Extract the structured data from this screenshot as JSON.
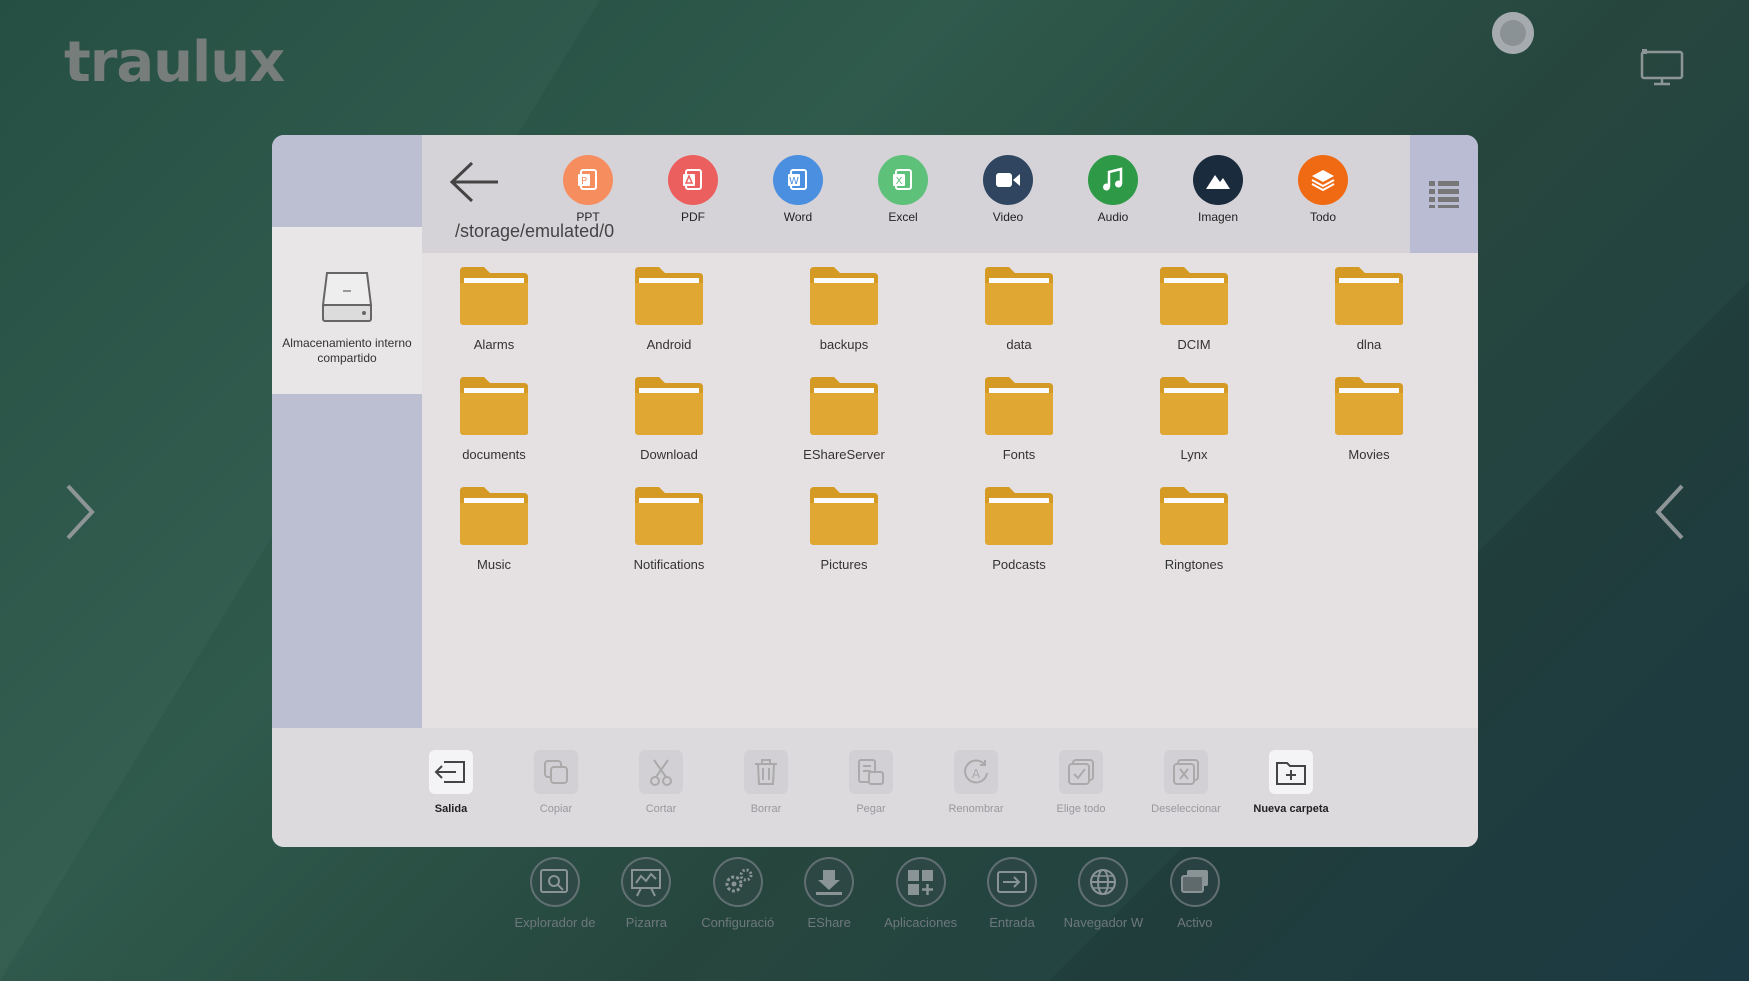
{
  "brand": {
    "logo": "traulux"
  },
  "path": "/storage/emulated/0",
  "sidebar": {
    "storage_label": "Almacenamiento interno compartido"
  },
  "categories": [
    {
      "label": "PPT",
      "icon": "ppt-icon",
      "color": "#f58d5f"
    },
    {
      "label": "PDF",
      "icon": "pdf-icon",
      "color": "#ec5f5f"
    },
    {
      "label": "Word",
      "icon": "word-icon",
      "color": "#4b8fe0"
    },
    {
      "label": "Excel",
      "icon": "excel-icon",
      "color": "#5ec179"
    },
    {
      "label": "Video",
      "icon": "video-icon",
      "color": "#2f4560"
    },
    {
      "label": "Audio",
      "icon": "music-icon",
      "color": "#2e9a47"
    },
    {
      "label": "Imagen",
      "icon": "image-icon",
      "color": "#1b2b3e"
    },
    {
      "label": "Todo",
      "icon": "layers-icon",
      "color": "#ef6a12"
    }
  ],
  "folders": [
    "Alarms",
    "Android",
    "backups",
    "data",
    "DCIM",
    "dlna",
    "documents",
    "Download",
    "EShareServer",
    "Fonts",
    "Lynx",
    "Movies",
    "Music",
    "Notifications",
    "Pictures",
    "Podcasts",
    "Ringtones"
  ],
  "actions": [
    {
      "label": "Salida",
      "icon": "exit-icon",
      "enabled": true
    },
    {
      "label": "Copiar",
      "icon": "copy-icon",
      "enabled": false
    },
    {
      "label": "Cortar",
      "icon": "scissors-icon",
      "enabled": false
    },
    {
      "label": "Borrar",
      "icon": "trash-icon",
      "enabled": false
    },
    {
      "label": "Pegar",
      "icon": "paste-icon",
      "enabled": false
    },
    {
      "label": "Renombrar",
      "icon": "rename-icon",
      "enabled": false
    },
    {
      "label": "Elige todo",
      "icon": "select-all-icon",
      "enabled": false
    },
    {
      "label": "Deseleccionar",
      "icon": "deselect-icon",
      "enabled": false
    },
    {
      "label": "Nueva carpeta",
      "icon": "new-folder-icon",
      "enabled": true
    }
  ],
  "dock": [
    {
      "label": "Explorador de",
      "icon": "file-explorer-icon"
    },
    {
      "label": "Pizarra",
      "icon": "whiteboard-icon"
    },
    {
      "label": "Configuració",
      "icon": "settings-icon"
    },
    {
      "label": "EShare",
      "icon": "eshare-icon"
    },
    {
      "label": "Aplicaciones",
      "icon": "apps-icon"
    },
    {
      "label": "Entrada",
      "icon": "input-icon"
    },
    {
      "label": "Navegador W",
      "icon": "browser-icon"
    },
    {
      "label": "Activo",
      "icon": "active-windows-icon"
    }
  ],
  "colors": {
    "folder": "#e0a832",
    "folder_tab": "#d49a24",
    "window_bg": "#e5e1e3",
    "sidebar_bg": "#bcbed2"
  }
}
